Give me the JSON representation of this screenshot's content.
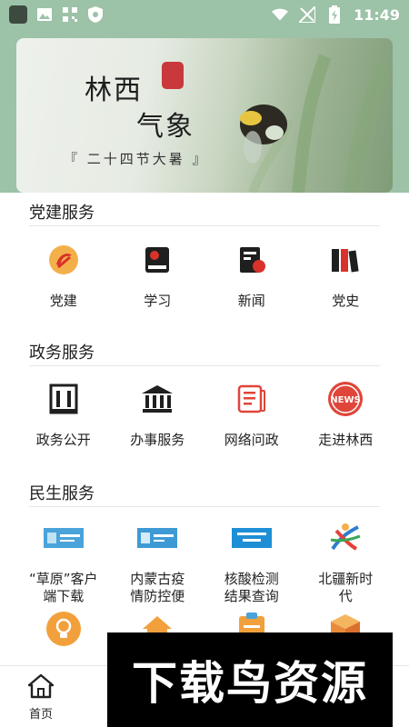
{
  "status_bar": {
    "time": "11:49"
  },
  "banner": {
    "title_line1": "林西",
    "title_line2": "气象",
    "subtitle": "『 二十四节大暑 』"
  },
  "sections": [
    {
      "title": "党建服务",
      "items": [
        {
          "label": "党建",
          "icon": "party-emblem-icon"
        },
        {
          "label": "学习",
          "icon": "book-icon"
        },
        {
          "label": "新闻",
          "icon": "news-icon"
        },
        {
          "label": "党史",
          "icon": "history-books-icon"
        }
      ]
    },
    {
      "title": "政务服务",
      "items": [
        {
          "label": "政务公开",
          "icon": "building-icon"
        },
        {
          "label": "办事服务",
          "icon": "government-icon"
        },
        {
          "label": "网络问政",
          "icon": "document-icon"
        },
        {
          "label": "走进林西",
          "icon": "news-badge-icon"
        }
      ]
    },
    {
      "title": "民生服务",
      "items": [
        {
          "label": "“草原”客户端下载",
          "icon": "banner-thumb-icon"
        },
        {
          "label": "内蒙古疫情防控便",
          "icon": "banner-thumb-icon"
        },
        {
          "label": "核酸检测结果查询",
          "icon": "banner-thumb-icon"
        },
        {
          "label": "北疆新时代",
          "icon": "logo-icon"
        }
      ]
    }
  ],
  "bottom_nav": {
    "home_label": "首页"
  },
  "watermark": {
    "text": "下载鸟资源"
  },
  "colors": {
    "header": "#9cc2a7",
    "accent_red": "#e0453a",
    "orange": "#f2a03c"
  }
}
